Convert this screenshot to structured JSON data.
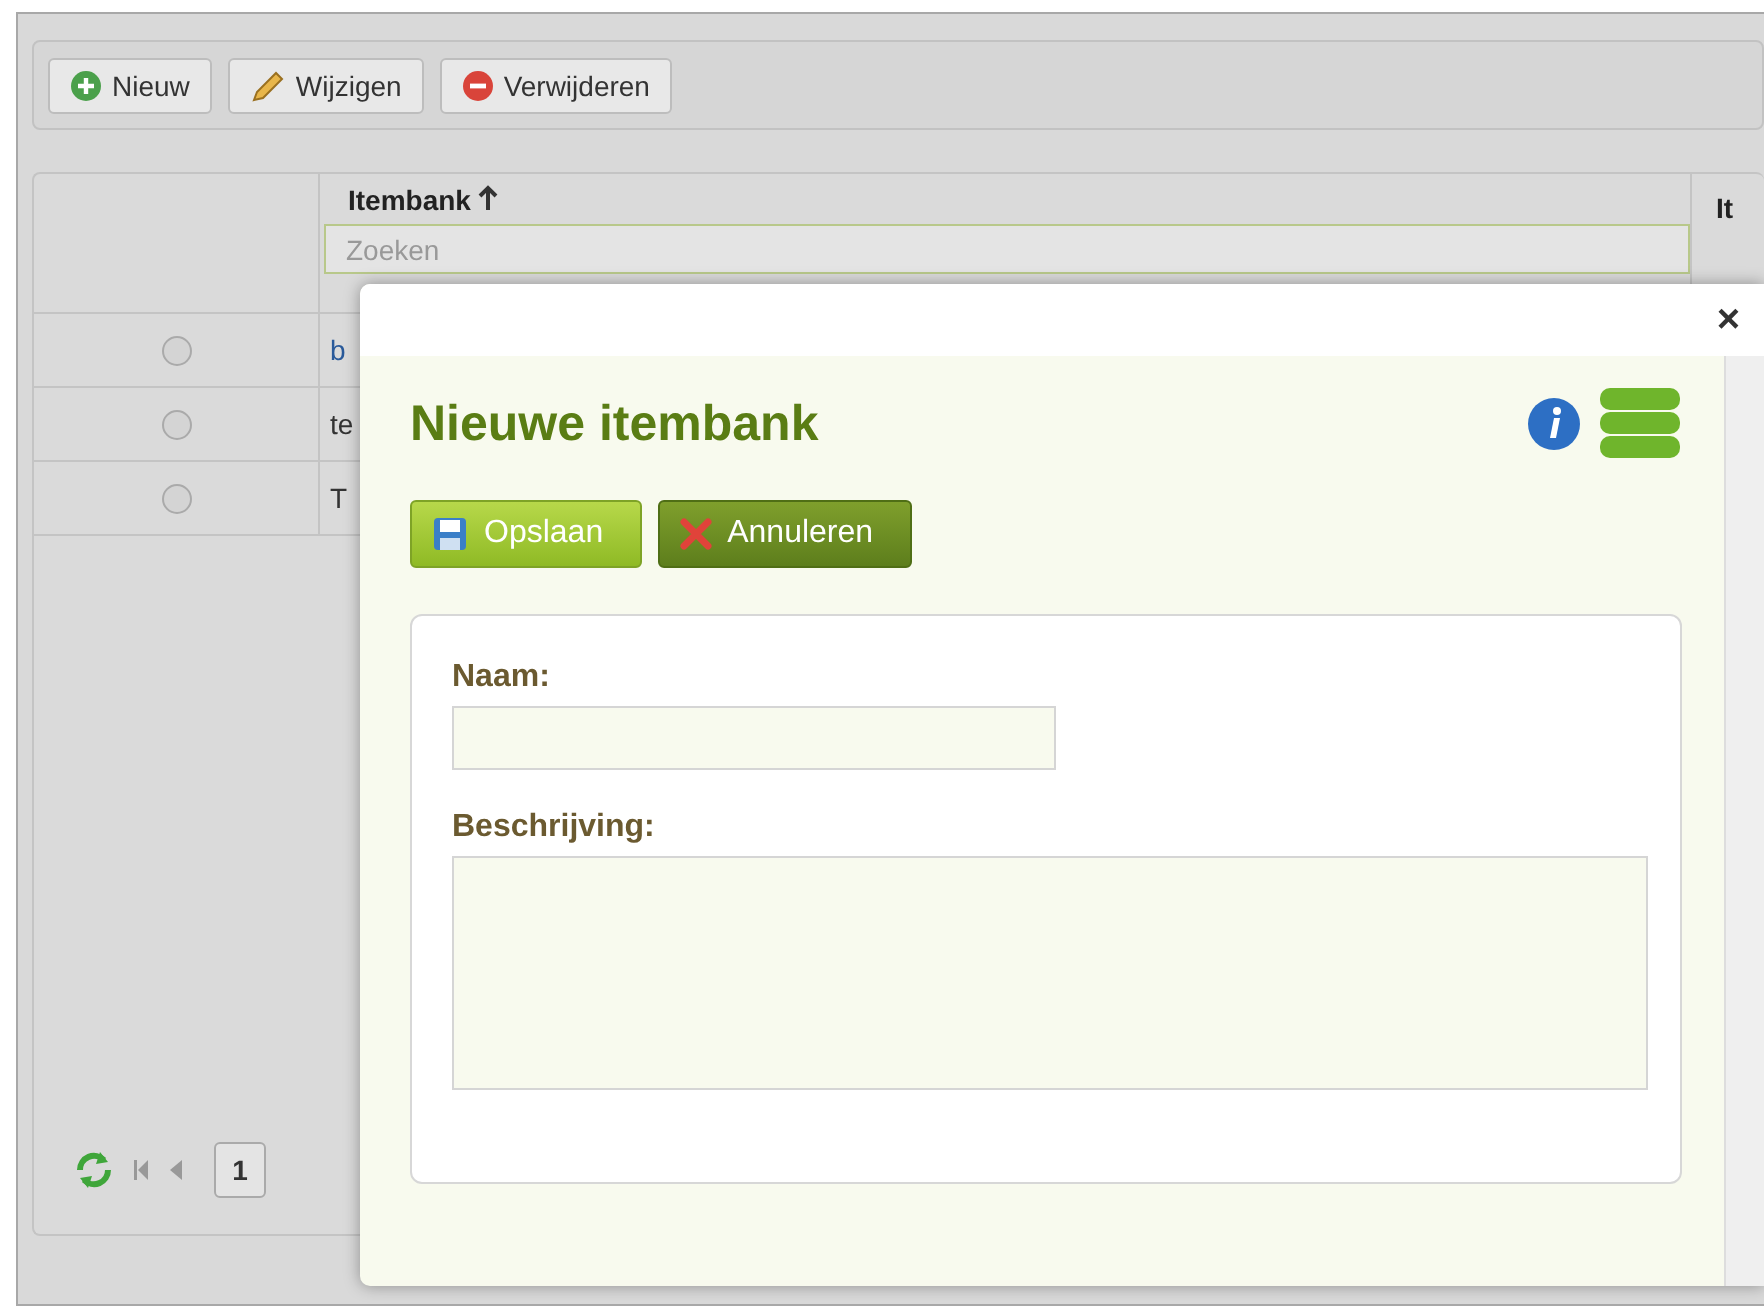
{
  "toolbar": {
    "buttons": [
      {
        "kind": "add",
        "label": "Nieuw"
      },
      {
        "kind": "edit",
        "label": "Wijzigen"
      },
      {
        "kind": "delete",
        "label": "Verwijderen"
      }
    ]
  },
  "grid": {
    "columns": [
      {
        "label": "Itembank"
      },
      {
        "label": "It"
      }
    ],
    "search": {
      "placeholder": "Zoeken"
    },
    "rows": [
      {
        "selected": false,
        "cell": "b"
      },
      {
        "selected": false,
        "cell": "te"
      },
      {
        "selected": false,
        "cell": "T"
      }
    ],
    "pager": {
      "page": "1"
    }
  },
  "dialog": {
    "close": "×",
    "title": "Nieuwe itembank",
    "buttons": [
      {
        "kind": "save",
        "label": "Opslaan"
      },
      {
        "kind": "cancel",
        "label": "Annuleren"
      }
    ],
    "fields": [
      {
        "kind": "input",
        "label": "Naam:"
      },
      {
        "kind": "textarea",
        "label": "Beschrijving:"
      }
    ]
  }
}
